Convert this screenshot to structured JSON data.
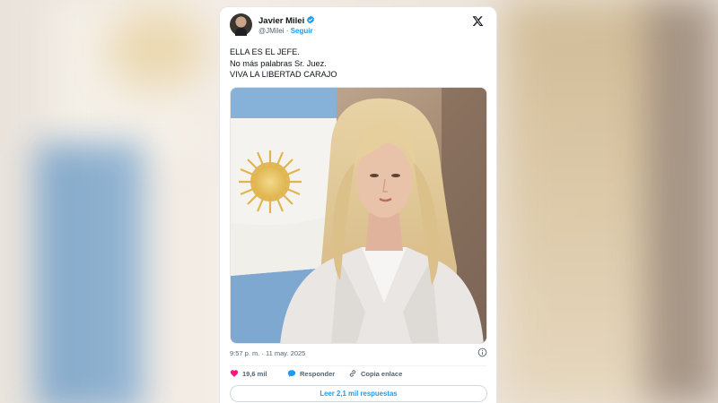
{
  "tweet": {
    "author_name": "Javier Milei",
    "handle": "@JMilei",
    "separator": "·",
    "follow_label": "Seguir",
    "text_lines": [
      "ELLA ES EL JEFE.",
      "No más palabras Sr. Juez.",
      "VIVA LA LIBERTAD CARAJO"
    ],
    "timestamp": "9:57 p. m. · 11 may. 2025",
    "likes": "19,6 mil",
    "reply_label": "Responder",
    "copy_link_label": "Copia enlace",
    "read_replies_label": "Leer 2,1 mil respuestas"
  },
  "icons": {
    "verified": "verified-badge-icon",
    "x_logo": "x-logo-icon",
    "info": "info-icon",
    "like": "heart-icon",
    "reply": "speech-bubble-icon",
    "copy_link": "link-icon"
  },
  "colors": {
    "accent": "#1d9bf0",
    "like": "#f91880",
    "text_primary": "#0f1419",
    "text_secondary": "#536471"
  }
}
